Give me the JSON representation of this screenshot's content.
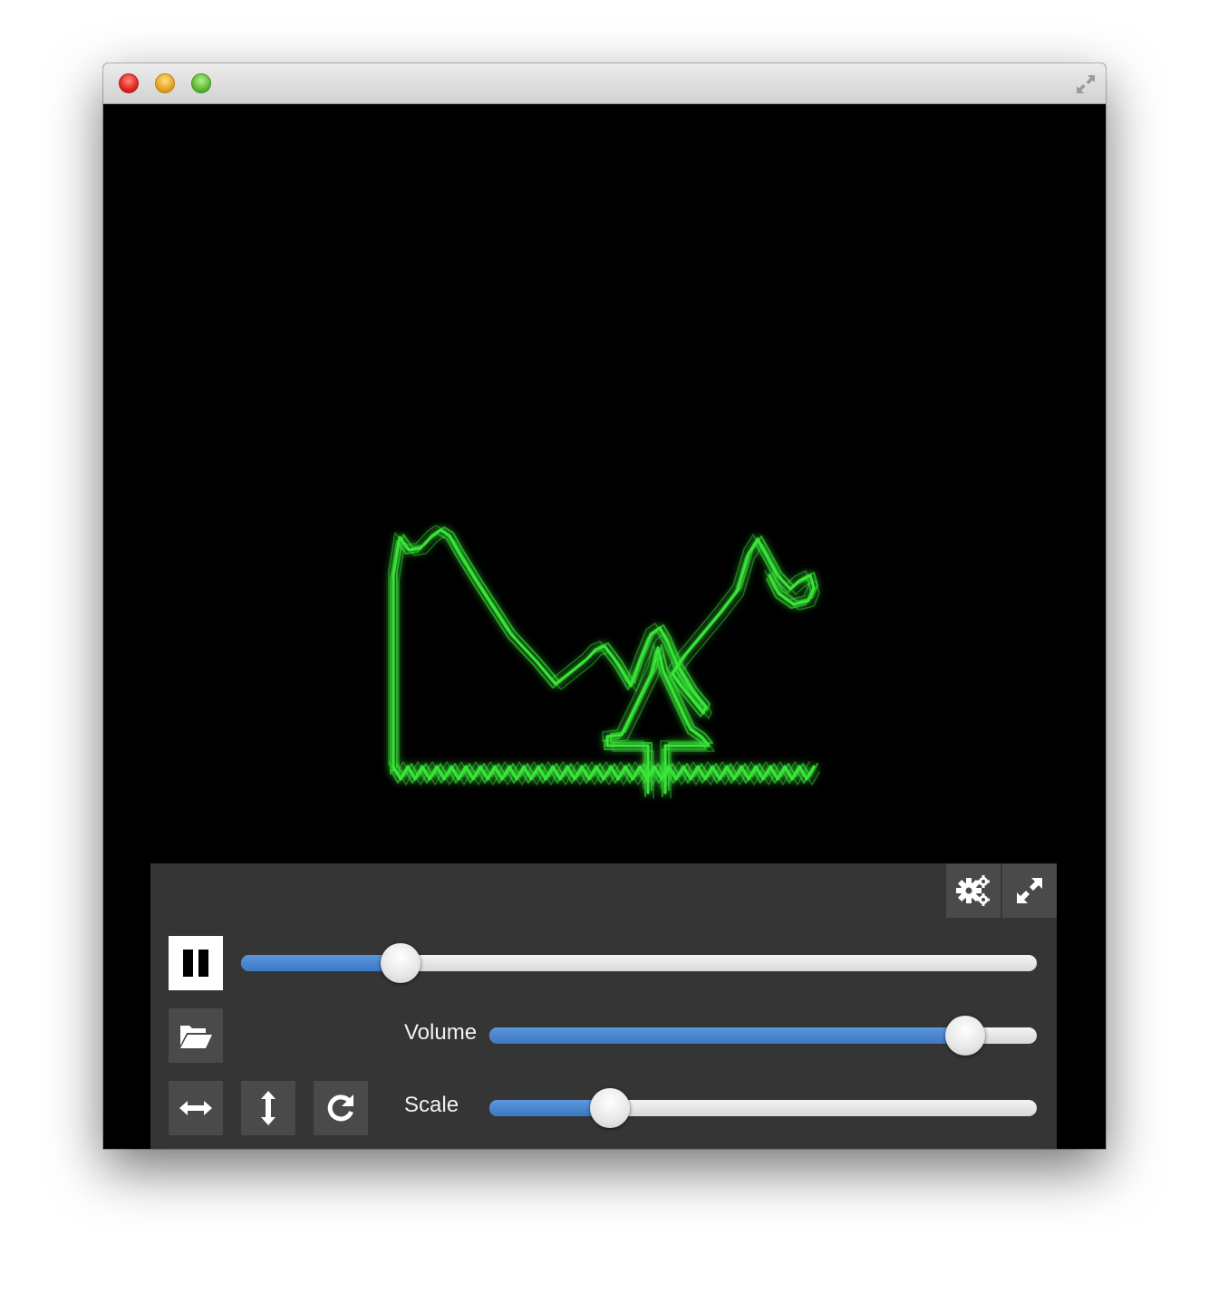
{
  "window": {
    "title": ""
  },
  "icons": {
    "window_fullscreen": "fullscreen-arrows-icon",
    "settings": "gears-icon",
    "fullscreen": "expand-icon",
    "play_pause": "pause-icon",
    "open": "folder-open-icon",
    "flip_horizontal": "horizontal-arrows-icon",
    "flip_vertical": "vertical-arrows-icon",
    "rotate": "rotate-icon"
  },
  "colors": {
    "trace": "#39e639",
    "slider_fill": "#4a88d4",
    "panel": "#353535",
    "button": "#4a4a4a"
  },
  "controls": {
    "position": {
      "value": 0.2
    },
    "volume": {
      "label": "Volume",
      "value": 0.87
    },
    "scale": {
      "label": "Scale",
      "value": 0.22
    }
  }
}
